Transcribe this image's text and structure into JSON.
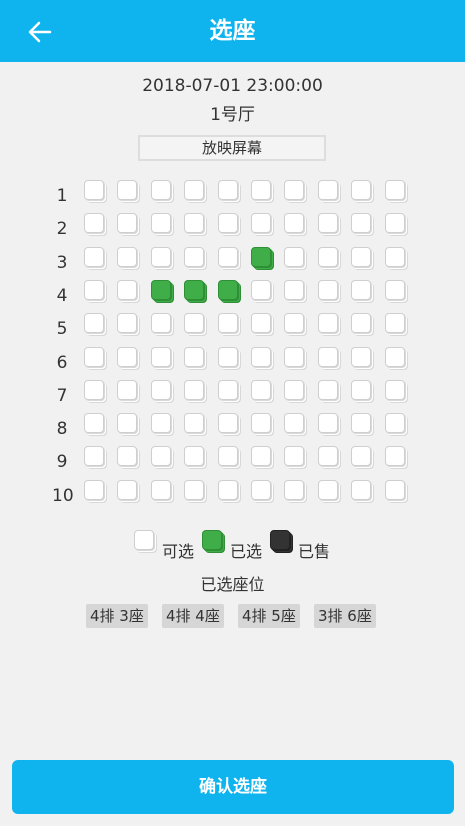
{
  "header": {
    "title": "选座",
    "back_icon": "arrow-left-icon"
  },
  "showtime": {
    "datetime": "2018-07-01 23:00:00",
    "hall": "1号厅"
  },
  "screen_label": "放映屏幕",
  "seat_map": {
    "rows": [
      "1",
      "2",
      "3",
      "4",
      "5",
      "6",
      "7",
      "8",
      "9",
      "10"
    ],
    "columns": 10,
    "selected": [
      [
        3,
        6
      ],
      [
        4,
        3
      ],
      [
        4,
        4
      ],
      [
        4,
        5
      ]
    ],
    "sold": []
  },
  "legend": {
    "available": "可选",
    "selected": "已选",
    "sold": "已售"
  },
  "selected_title": "已选座位",
  "selected_seats": [
    "4排 3座",
    "4排 4座",
    "4排 5座",
    "3排 6座"
  ],
  "confirm_label": "确认选座",
  "colors": {
    "accent": "#0fb4ee",
    "selected": "#3fae49",
    "sold": "#333333"
  }
}
